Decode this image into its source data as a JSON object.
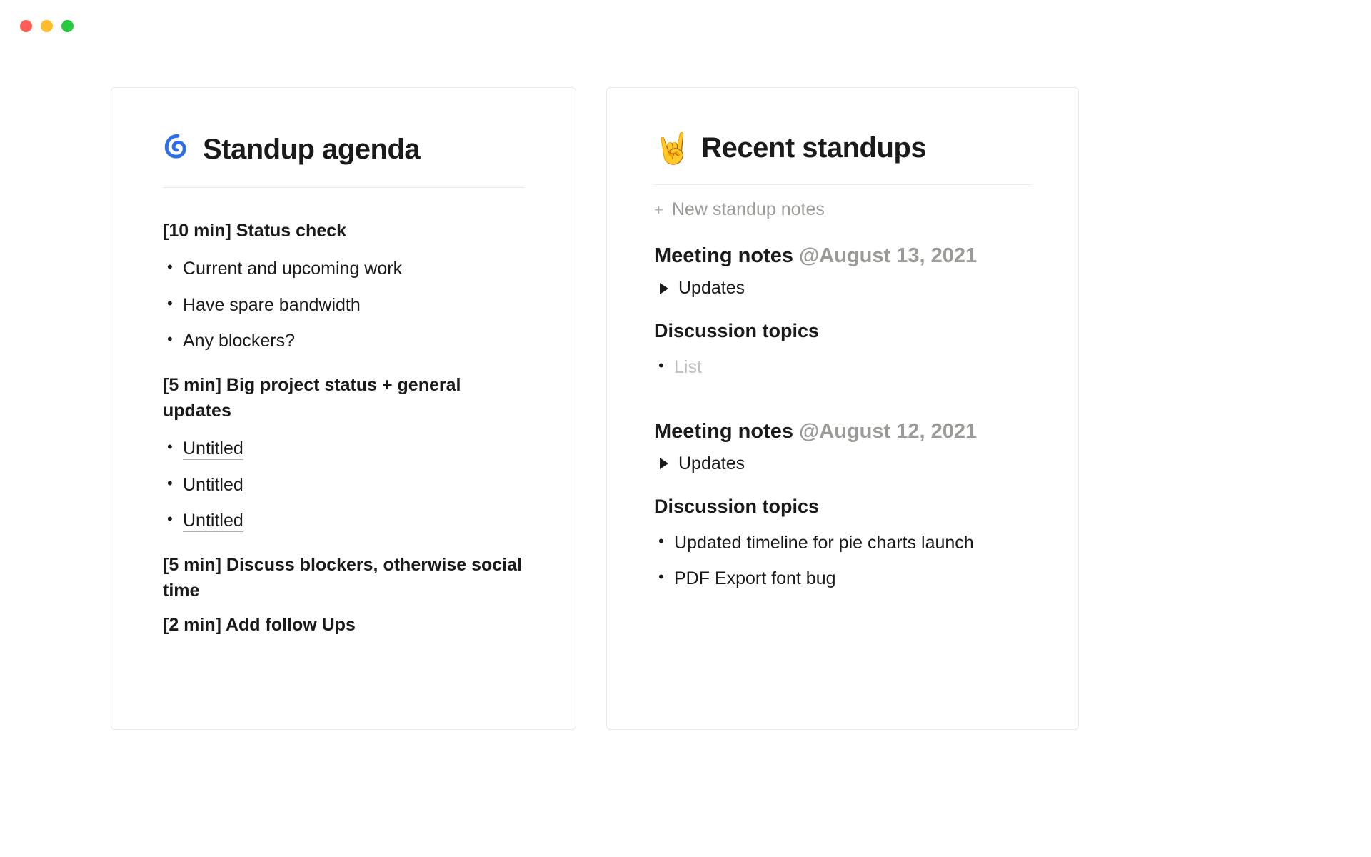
{
  "agenda": {
    "icon": "spiral",
    "title": "Standup agenda",
    "sections": [
      {
        "heading": "[10 min] Status check",
        "items": [
          "Current and upcoming work",
          "Have spare bandwidth",
          "Any blockers?"
        ]
      },
      {
        "heading": "[5 min] Big project status + general updates",
        "link_items": [
          "Untitled",
          "Untitled",
          "Untitled"
        ]
      },
      {
        "heading": "[5 min] Discuss blockers, otherwise social time"
      },
      {
        "heading": "[2 min] Add follow Ups"
      }
    ]
  },
  "recent": {
    "icon": "🤘",
    "title": "Recent standups",
    "new_button": "New standup notes",
    "entries": [
      {
        "title": "Meeting notes",
        "date": "@August 13, 2021",
        "toggle": "Updates",
        "discussion_heading": "Discussion topics",
        "discussion_items": [
          {
            "text": "List",
            "placeholder": true
          }
        ]
      },
      {
        "title": "Meeting notes",
        "date": "@August 12, 2021",
        "toggle": "Updates",
        "discussion_heading": "Discussion topics",
        "discussion_items": [
          {
            "text": "Updated timeline for pie charts launch"
          },
          {
            "text": "PDF Export font bug"
          }
        ]
      }
    ]
  }
}
